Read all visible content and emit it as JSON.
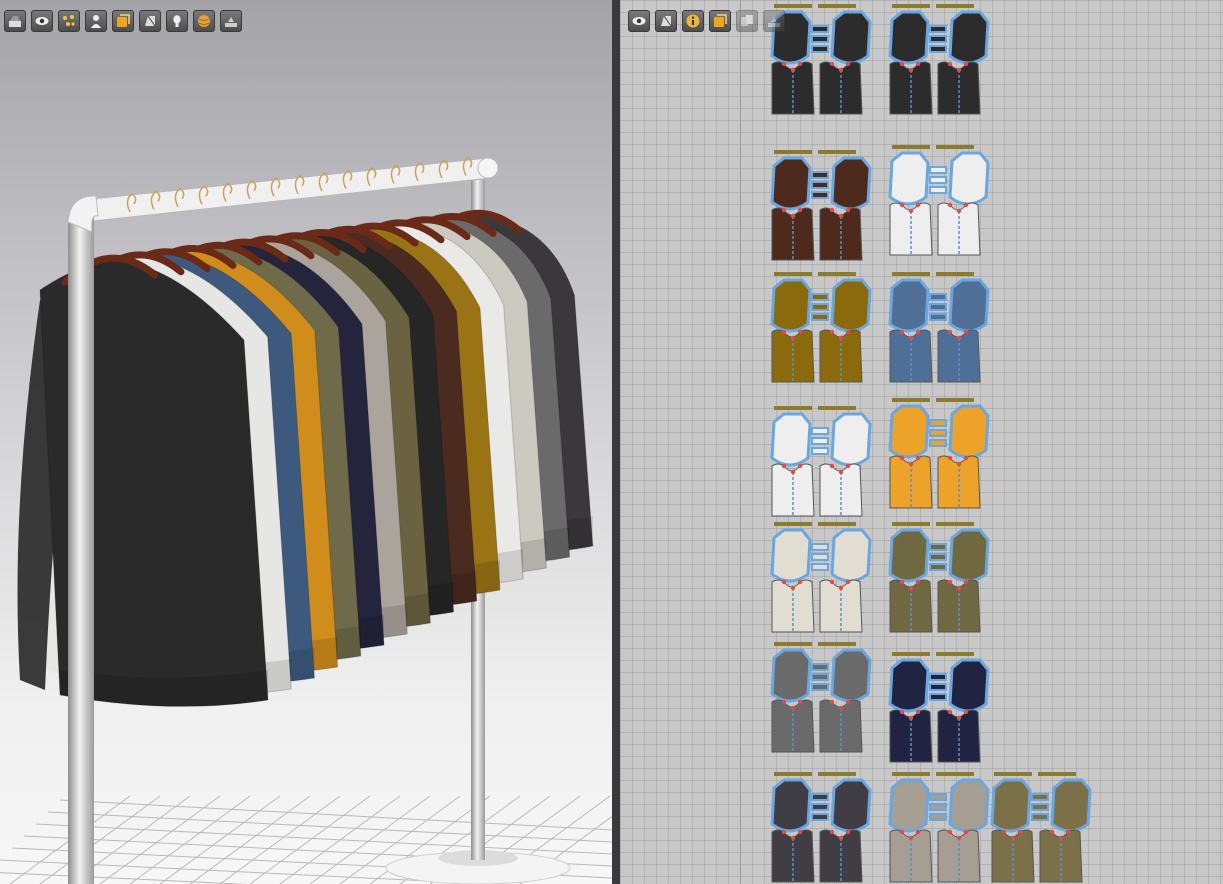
{
  "viewport_3d": {
    "toolbar": [
      {
        "icon": "render-mode-icon"
      },
      {
        "icon": "visibility-eye-icon"
      },
      {
        "icon": "point-display-icon"
      },
      {
        "icon": "avatar-icon"
      },
      {
        "icon": "texture-display-icon"
      },
      {
        "icon": "garment-display-icon"
      },
      {
        "icon": "avatar-head-icon"
      },
      {
        "icon": "fabric-ball-icon"
      },
      {
        "icon": "arrangement-icon"
      }
    ],
    "garments": [
      {
        "color": "#2a2a2a"
      },
      {
        "color": "#e6e6e4"
      },
      {
        "color": "#3d5a7e"
      },
      {
        "color": "#d08d1c"
      },
      {
        "color": "#6f6a49"
      },
      {
        "color": "#24253d"
      },
      {
        "color": "#aaa49c"
      },
      {
        "color": "#6b6241"
      },
      {
        "color": "#262626"
      },
      {
        "color": "#4b2a1f"
      },
      {
        "color": "#9a7314"
      },
      {
        "color": "#e9e9e7"
      },
      {
        "color": "#ccc9c1"
      },
      {
        "color": "#6a6a6a"
      },
      {
        "color": "#3b383c"
      }
    ]
  },
  "viewport_2d": {
    "toolbar": [
      {
        "icon": "visibility-eye-icon",
        "enabled": true
      },
      {
        "icon": "garment-display-icon",
        "enabled": true
      },
      {
        "icon": "info-icon",
        "enabled": true
      },
      {
        "icon": "texture-display-icon",
        "enabled": true
      },
      {
        "icon": "pattern-copy-icon",
        "enabled": false
      },
      {
        "icon": "arrangement-icon",
        "enabled": false
      }
    ],
    "pattern_sets": [
      {
        "color": "#2c2c2c"
      },
      {
        "color": "#2c2c2c"
      },
      {
        "color": "#4d2a1b"
      },
      {
        "color": "#eeeeee"
      },
      {
        "color": "#8b6a0e"
      },
      {
        "color": "#4f6f97"
      },
      {
        "color": "#eeeeee"
      },
      {
        "color": "#eda22a"
      },
      {
        "color": "#e2ddd1"
      },
      {
        "color": "#6f6841"
      },
      {
        "color": "#6a6a6a"
      },
      {
        "color": "#202341"
      },
      {
        "color": "#403d44"
      },
      {
        "color": "#a69d93"
      },
      {
        "color": "#7b7047"
      }
    ]
  }
}
